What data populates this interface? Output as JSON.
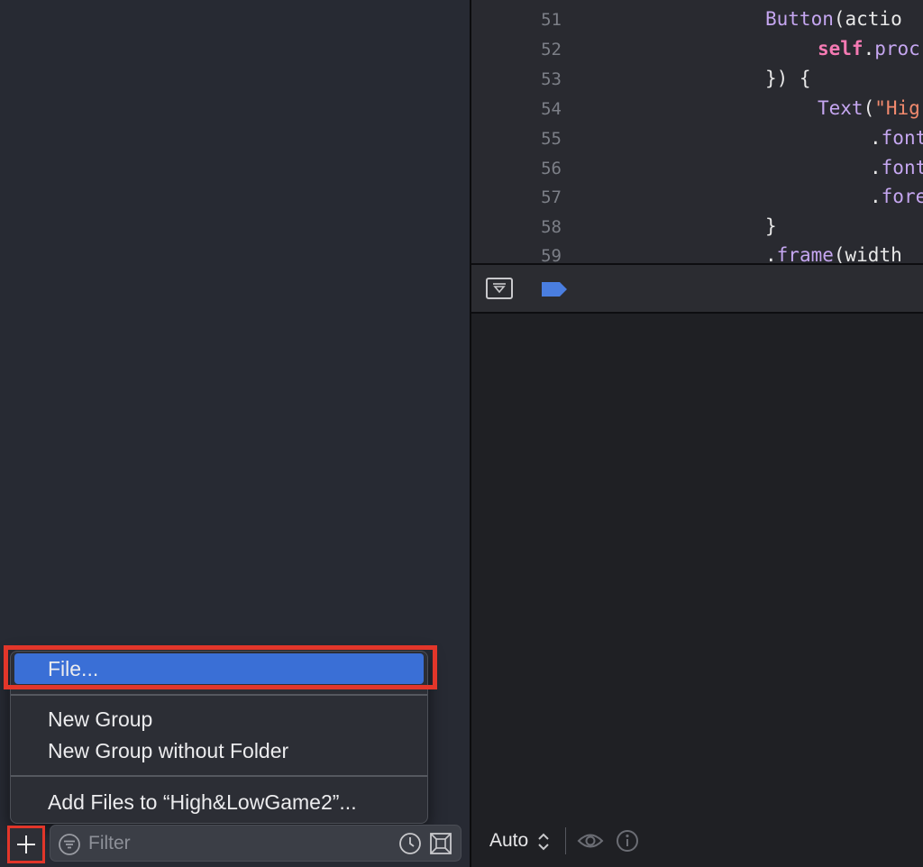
{
  "editor": {
    "lines": [
      {
        "num": "51",
        "indent": 326,
        "tokens": [
          {
            "t": "func",
            "v": "Button"
          },
          {
            "t": "plain",
            "v": "(actio"
          }
        ]
      },
      {
        "num": "52",
        "indent": 384,
        "tokens": [
          {
            "t": "kw",
            "v": "self"
          },
          {
            "t": "plain",
            "v": "."
          },
          {
            "t": "func",
            "v": "proc"
          }
        ]
      },
      {
        "num": "53",
        "indent": 326,
        "tokens": [
          {
            "t": "plain",
            "v": "}) {"
          }
        ]
      },
      {
        "num": "54",
        "indent": 384,
        "tokens": [
          {
            "t": "func",
            "v": "Text"
          },
          {
            "t": "plain",
            "v": "("
          },
          {
            "t": "str",
            "v": "\"Hig"
          }
        ]
      },
      {
        "num": "55",
        "indent": 442,
        "tokens": [
          {
            "t": "plain",
            "v": "."
          },
          {
            "t": "func",
            "v": "font"
          }
        ]
      },
      {
        "num": "56",
        "indent": 442,
        "tokens": [
          {
            "t": "plain",
            "v": "."
          },
          {
            "t": "func",
            "v": "font"
          }
        ]
      },
      {
        "num": "57",
        "indent": 442,
        "tokens": [
          {
            "t": "plain",
            "v": "."
          },
          {
            "t": "func",
            "v": "fore"
          }
        ]
      },
      {
        "num": "58",
        "indent": 326,
        "tokens": [
          {
            "t": "plain",
            "v": "}"
          }
        ]
      },
      {
        "num": "59",
        "indent": 326,
        "tokens": [
          {
            "t": "plain",
            "v": "."
          },
          {
            "t": "func",
            "v": "frame"
          },
          {
            "t": "plain",
            "v": "(width"
          }
        ]
      }
    ]
  },
  "popup_menu": {
    "items": [
      {
        "label": "File...",
        "selected": true
      },
      {
        "label": "New Group",
        "selected": false
      },
      {
        "label": "New Group without Folder",
        "selected": false
      },
      {
        "label": "Add Files to “High&LowGame2”...",
        "selected": false
      }
    ]
  },
  "filter": {
    "placeholder": "Filter"
  },
  "console": {
    "mode_label": "Auto"
  },
  "colors": {
    "accent": "#3a6fd6",
    "highlight": "#e2362a",
    "breakpoint": "#4a7ee0"
  },
  "icons": {
    "add": "plus-icon",
    "filter": "filter-icon",
    "recent": "clock-icon",
    "scm": "source-control-filter-icon",
    "debug_toggle": "hide-debug-area-icon",
    "breakpoints": "breakpoint-icon",
    "eye": "eye-icon",
    "info": "info-icon"
  }
}
